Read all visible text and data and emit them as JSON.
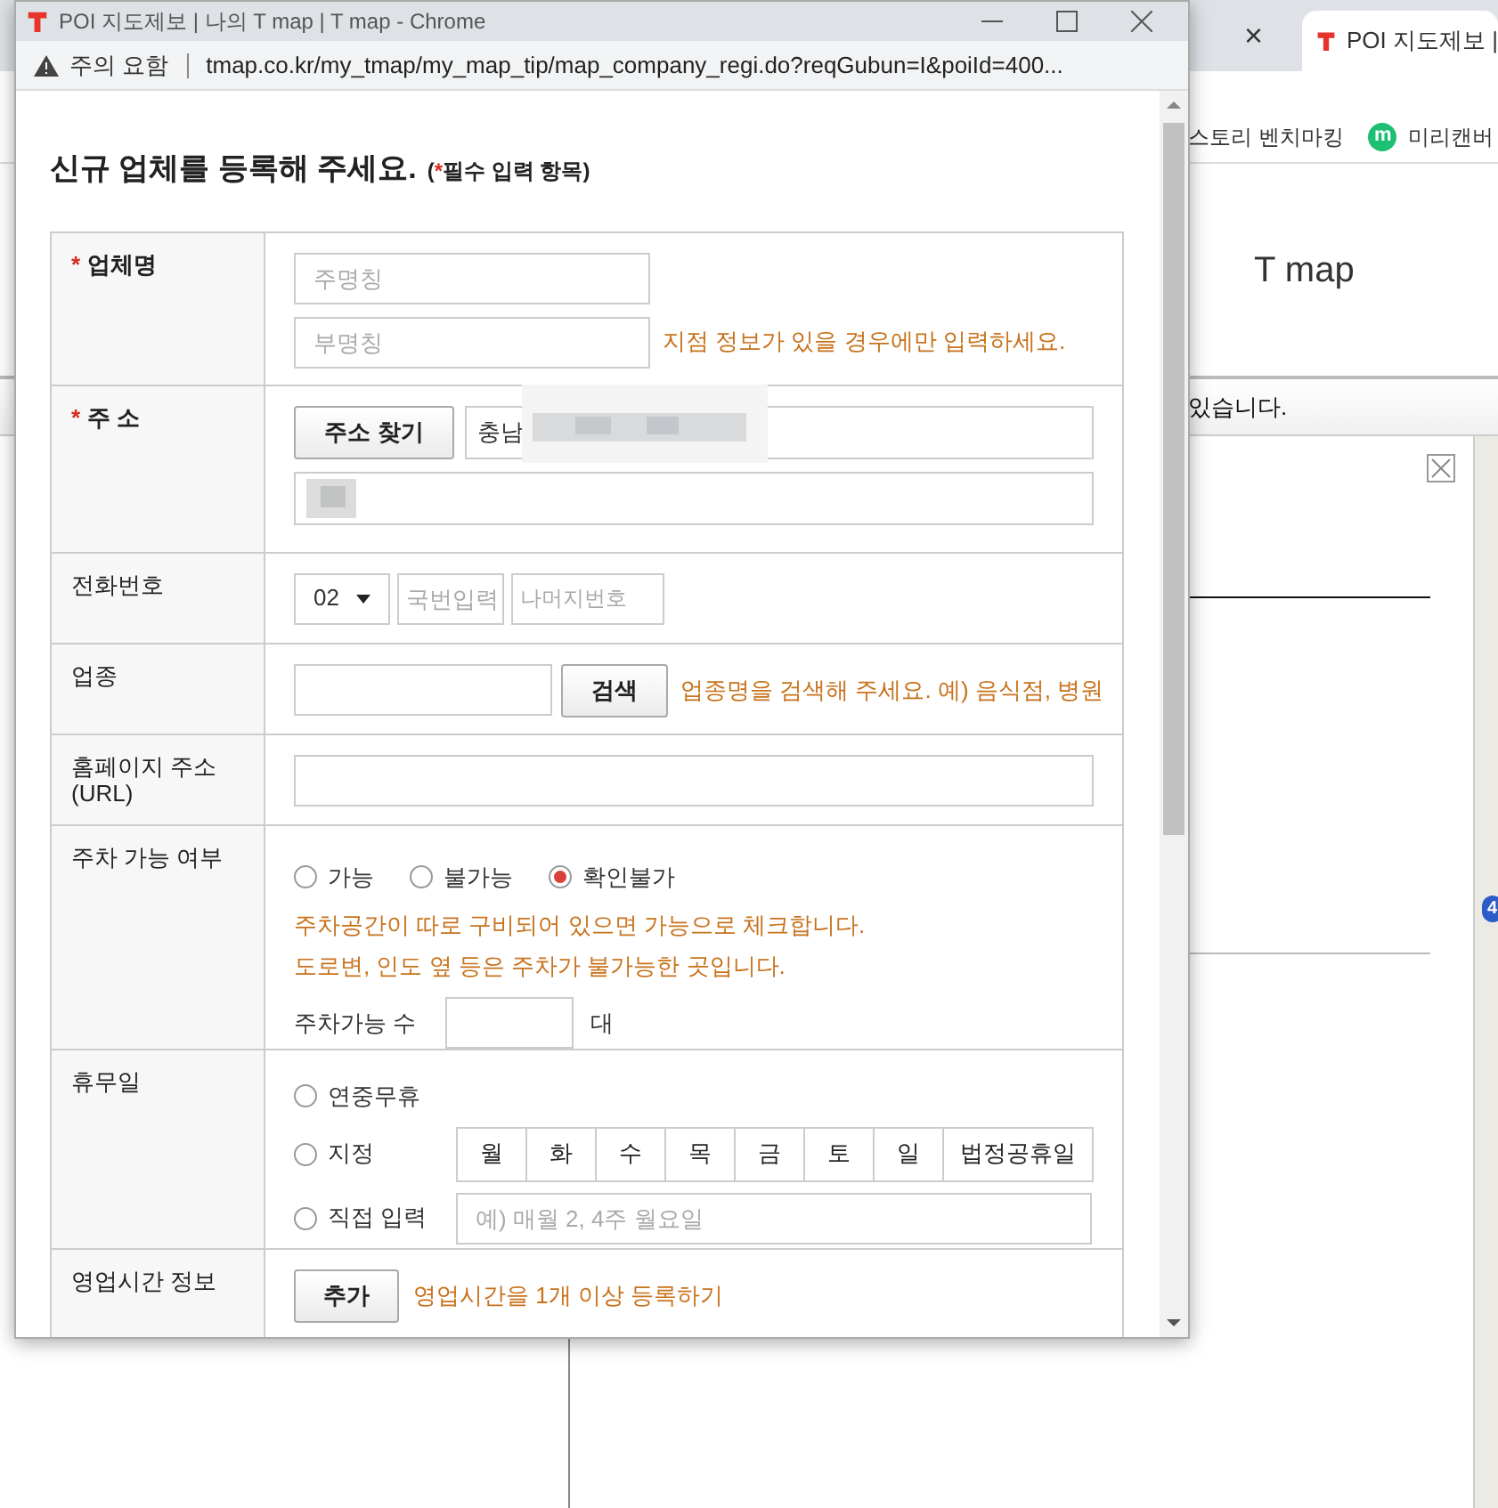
{
  "background": {
    "tab": {
      "close": "×",
      "title": "POI 지도제보 |"
    },
    "bookmarks": [
      {
        "label": "스토리 벤치마킹"
      },
      {
        "label": "미리캔버",
        "icon_text": "m"
      }
    ],
    "header": "T map",
    "notice": "있습니다.",
    "map_badge": "4"
  },
  "popup": {
    "title": "POI 지도제보 | 나의 T map | T map - Chrome",
    "security": "주의 요함",
    "url": "tmap.co.kr/my_tmap/my_map_tip/map_company_regi.do?reqGubun=I&poiId=400...",
    "heading": "신규 업체를 등록해 주세요.",
    "note_open": "(",
    "note_mark": "*",
    "note_text": "필수 입력 항목)",
    "rows": [
      {
        "kind": "name",
        "label": "업체명",
        "required_mark": "*",
        "placeholders": [
          "주명칭",
          "부명칭"
        ],
        "hint": "지점 정보가 있을 경우에만 입력하세요."
      },
      {
        "kind": "address",
        "label": "주 소",
        "required_mark": "*",
        "button": "주소 찾기",
        "value": "충남"
      },
      {
        "kind": "phone",
        "label": "전화번호",
        "select": "02",
        "placeholders": [
          "국번입력",
          "나머지번호"
        ]
      },
      {
        "kind": "category",
        "label": "업종",
        "button": "검색",
        "hint": "업종명을 검색해 주세요. 예) 음식점, 병원"
      },
      {
        "kind": "url",
        "label": "홈페이지 주소\n(URL)"
      },
      {
        "kind": "parking",
        "label": "주차 가능 여부",
        "options": [
          {
            "label": "가능",
            "selected": false
          },
          {
            "label": "불가능",
            "selected": false
          },
          {
            "label": "확인불가",
            "selected": true
          }
        ],
        "notes": [
          "주차공간이 따로 구비되어 있으면 가능으로 체크합니다.",
          "도로변, 인도 옆 등은 주차가 불가능한 곳입니다."
        ],
        "count_label": "주차가능 수",
        "unit": "대"
      },
      {
        "kind": "holiday",
        "label": "휴무일",
        "options": [
          {
            "kind": "plain",
            "label": "연중무휴",
            "selected": false
          },
          {
            "kind": "days",
            "label": "지정",
            "selected": false,
            "days": [
              "월",
              "화",
              "수",
              "목",
              "금",
              "토",
              "일",
              "법정공휴일"
            ]
          },
          {
            "kind": "input",
            "label": "직접 입력",
            "selected": false,
            "placeholder": "예) 매월 2, 4주 월요일"
          }
        ]
      },
      {
        "kind": "hours",
        "label": "영업시간 정보",
        "button": "추가",
        "hint": "영업시간을 1개 이상 등록하기"
      },
      {
        "kind": "empty"
      }
    ]
  }
}
